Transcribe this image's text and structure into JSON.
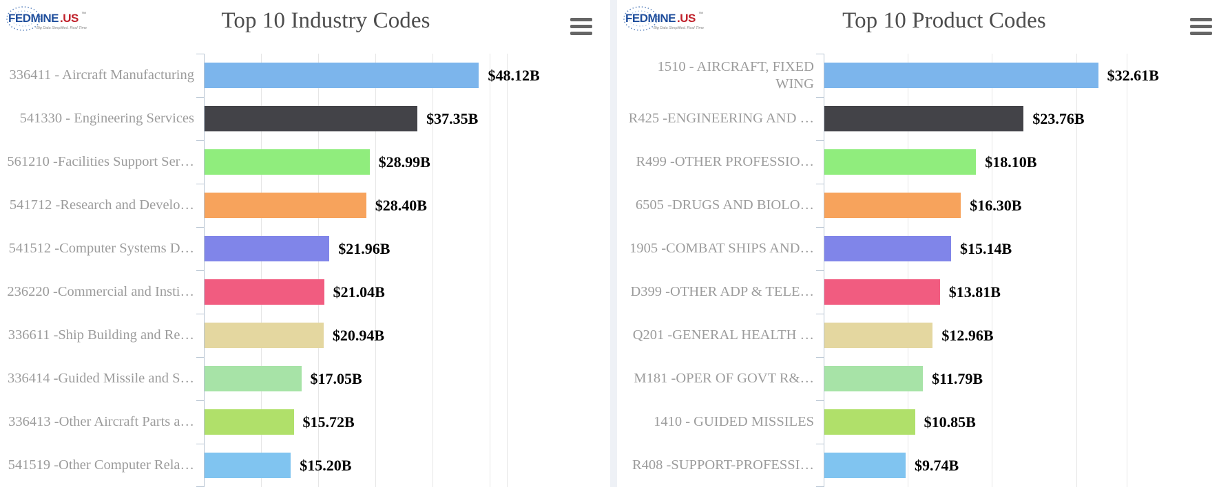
{
  "brand": {
    "logo_text": "FEDMINE.US",
    "logo_tagline": "Big Data Simplified. Real Time.",
    "logo_trademark": "™"
  },
  "panels": [
    {
      "title": "Top 10 Industry Codes",
      "menu_icon": "hamburger-menu-icon",
      "chart_data": {
        "type": "bar",
        "orientation": "horizontal",
        "title": "Top 10 Industry Codes",
        "xlabel": "",
        "ylabel": "",
        "grid": true,
        "legend": false,
        "xlim": [
          0,
          53
        ],
        "value_suffix": "B",
        "value_prefix": "$",
        "categories": [
          "336411 - Aircraft Manufacturing",
          "541330 - Engineering Services",
          "561210 -Facilities Support Ser…",
          "541712 -Research and Develo…",
          "541512 -Computer Systems D…",
          "236220 -Commercial and Insti…",
          "336611 -Ship Building and Re…",
          "336414 -Guided Missile and S…",
          "336413 -Other Aircraft Parts a…",
          "541519 -Other Computer Rela…"
        ],
        "values": [
          48.12,
          37.35,
          28.99,
          28.4,
          21.96,
          21.04,
          20.94,
          17.05,
          15.72,
          15.2
        ],
        "value_labels": [
          "$48.12B",
          "$37.35B",
          "$28.99B",
          "$28.40B",
          "$21.96B",
          "$21.04B",
          "$20.94B",
          "$17.05B",
          "$15.72B",
          "$15.20B"
        ],
        "colors": [
          "#7cb5ec",
          "#434348",
          "#90ed7d",
          "#f7a35c",
          "#8085e9",
          "#f15c80",
          "#e4d7a0",
          "#a7e3a7",
          "#b0e06a",
          "#80c4f0"
        ]
      }
    },
    {
      "title": "Top 10 Product Codes",
      "menu_icon": "hamburger-menu-icon",
      "chart_data": {
        "type": "bar",
        "orientation": "horizontal",
        "title": "Top 10 Product Codes",
        "xlabel": "",
        "ylabel": "",
        "grid": true,
        "legend": false,
        "xlim": [
          0,
          36
        ],
        "value_suffix": "B",
        "value_prefix": "$",
        "categories": [
          "1510 - AIRCRAFT, FIXED WING",
          "R425 -ENGINEERING AND …",
          "R499 -OTHER PROFESSIO…",
          "6505 -DRUGS AND BIOLO…",
          "1905 -COMBAT SHIPS AND…",
          "D399 -OTHER ADP & TELE…",
          "Q201 -GENERAL HEALTH …",
          "M181 -OPER OF GOVT R&…",
          "1410 - GUIDED MISSILES",
          "R408 -SUPPORT-PROFESSI…"
        ],
        "values": [
          32.61,
          23.76,
          18.1,
          16.3,
          15.14,
          13.81,
          12.96,
          11.79,
          10.85,
          9.74
        ],
        "value_labels": [
          "$32.61B",
          "$23.76B",
          "$18.10B",
          "$16.30B",
          "$15.14B",
          "$13.81B",
          "$12.96B",
          "$11.79B",
          "$10.85B",
          "$9.74B"
        ],
        "colors": [
          "#7cb5ec",
          "#434348",
          "#90ed7d",
          "#f7a35c",
          "#8085e9",
          "#f15c80",
          "#e4d7a0",
          "#a7e3a7",
          "#b0e06a",
          "#80c4f0"
        ]
      }
    }
  ]
}
